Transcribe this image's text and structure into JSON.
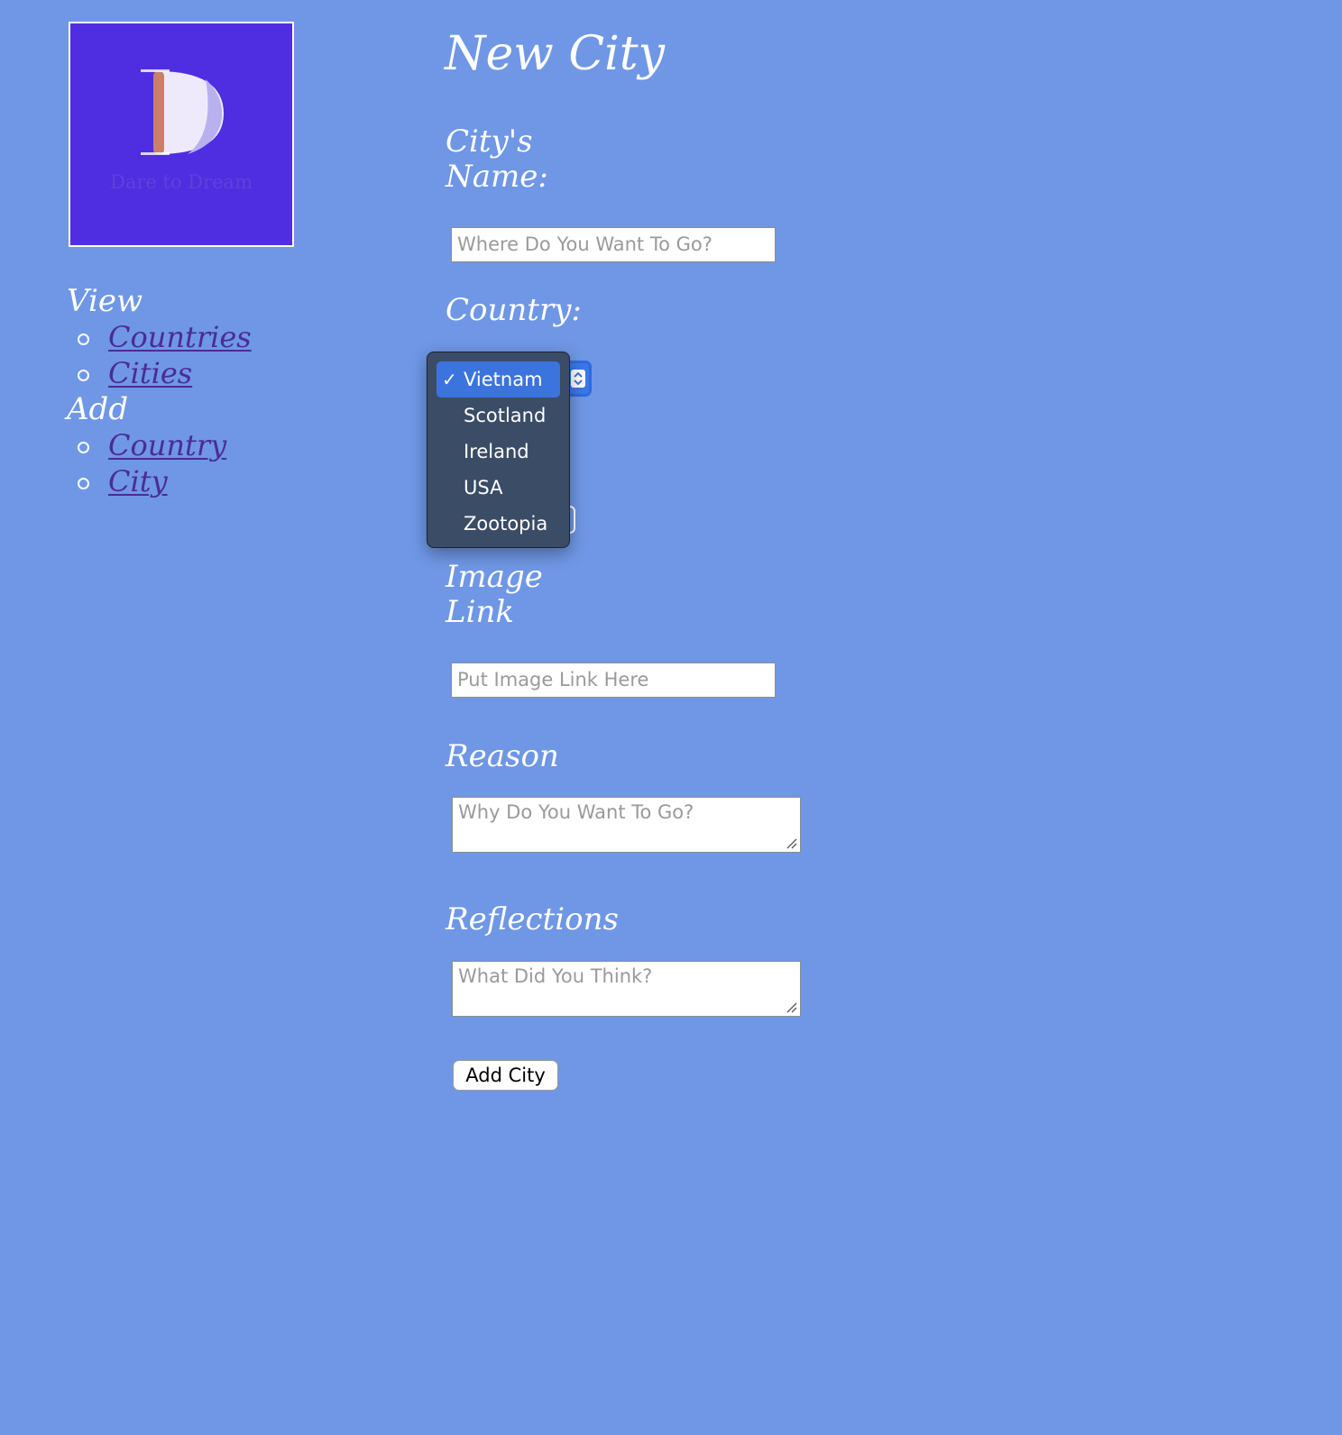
{
  "logo": {
    "tagline": "Dare to Dream"
  },
  "nav": {
    "view_heading": "View",
    "view_items": [
      {
        "label": "Countries"
      },
      {
        "label": "Cities"
      }
    ],
    "add_heading": "Add",
    "add_items": [
      {
        "label": "Country"
      },
      {
        "label": "City"
      }
    ]
  },
  "form": {
    "title": "New City",
    "city_name_label": "City's Name:",
    "city_name_placeholder": "Where Do You Want To Go?",
    "country_label": "Country:",
    "country_select": {
      "selected": "Vietnam",
      "options": [
        "Vietnam",
        "Scotland",
        "Ireland",
        "USA",
        "Zootopia"
      ]
    },
    "image_link_label": "Image Link",
    "image_link_placeholder": "Put Image Link Here",
    "reason_label": "Reason",
    "reason_placeholder": "Why Do You Want To Go?",
    "reflections_label": "Reflections",
    "reflections_placeholder": "What Did You Think?",
    "submit_label": "Add City"
  },
  "colors": {
    "background": "#6f97e5",
    "logo_background": "#4f2de1",
    "link": "#4a2b9a",
    "dropdown_background": "#3a4c66",
    "dropdown_selected": "#3c74de"
  }
}
